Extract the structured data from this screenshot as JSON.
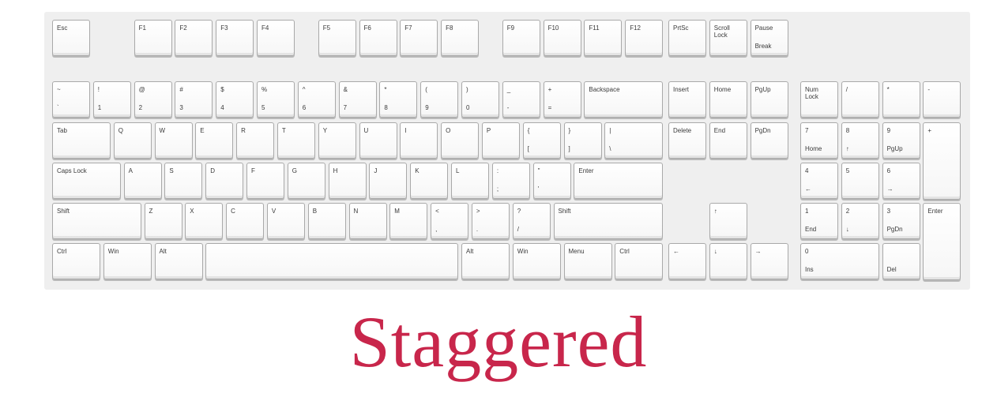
{
  "title": "Staggered",
  "colors": {
    "title": "#c8264b",
    "keycap": "#ffffff",
    "keycap_border": "#a9a9a9",
    "board": "#efefef"
  },
  "rows": {
    "function": [
      {
        "id": "esc",
        "top": "Esc"
      },
      {
        "id": "f1",
        "top": "F1"
      },
      {
        "id": "f2",
        "top": "F2"
      },
      {
        "id": "f3",
        "top": "F3"
      },
      {
        "id": "f4",
        "top": "F4"
      },
      {
        "id": "f5",
        "top": "F5"
      },
      {
        "id": "f6",
        "top": "F6"
      },
      {
        "id": "f7",
        "top": "F7"
      },
      {
        "id": "f8",
        "top": "F8"
      },
      {
        "id": "f9",
        "top": "F9"
      },
      {
        "id": "f10",
        "top": "F10"
      },
      {
        "id": "f11",
        "top": "F11"
      },
      {
        "id": "f12",
        "top": "F12"
      },
      {
        "id": "prtsc",
        "top": "PrtSc"
      },
      {
        "id": "scroll-lock",
        "top": "Scroll\nLock"
      },
      {
        "id": "pause",
        "top": "Pause",
        "bottom": "Break"
      }
    ],
    "number": [
      {
        "id": "backtick",
        "top": "~",
        "bottom": "`"
      },
      {
        "id": "1",
        "top": "!",
        "bottom": "1"
      },
      {
        "id": "2",
        "top": "@",
        "bottom": "2"
      },
      {
        "id": "3",
        "top": "#",
        "bottom": "3"
      },
      {
        "id": "4",
        "top": "$",
        "bottom": "4"
      },
      {
        "id": "5",
        "top": "%",
        "bottom": "5"
      },
      {
        "id": "6",
        "top": "^",
        "bottom": "6"
      },
      {
        "id": "7",
        "top": "&",
        "bottom": "7"
      },
      {
        "id": "8",
        "top": "*",
        "bottom": "8"
      },
      {
        "id": "9",
        "top": "(",
        "bottom": "9"
      },
      {
        "id": "0",
        "top": ")",
        "bottom": "0"
      },
      {
        "id": "minus",
        "top": "_",
        "bottom": "-"
      },
      {
        "id": "equals",
        "top": "+",
        "bottom": "="
      },
      {
        "id": "backspace",
        "top": "Backspace"
      },
      {
        "id": "insert",
        "top": "Insert"
      },
      {
        "id": "home",
        "top": "Home"
      },
      {
        "id": "pgup",
        "top": "PgUp"
      },
      {
        "id": "num-lock",
        "top": "Num\nLock"
      },
      {
        "id": "num-slash",
        "top": "/"
      },
      {
        "id": "num-star",
        "top": "*"
      },
      {
        "id": "num-minus",
        "top": "-"
      }
    ],
    "top": [
      {
        "id": "tab",
        "top": "Tab"
      },
      {
        "id": "q",
        "top": "Q"
      },
      {
        "id": "w",
        "top": "W"
      },
      {
        "id": "e",
        "top": "E"
      },
      {
        "id": "r",
        "top": "R"
      },
      {
        "id": "t",
        "top": "T"
      },
      {
        "id": "y",
        "top": "Y"
      },
      {
        "id": "u",
        "top": "U"
      },
      {
        "id": "i",
        "top": "I"
      },
      {
        "id": "o",
        "top": "O"
      },
      {
        "id": "p",
        "top": "P"
      },
      {
        "id": "lbracket",
        "top": "{",
        "bottom": "["
      },
      {
        "id": "rbracket",
        "top": "}",
        "bottom": "]"
      },
      {
        "id": "backslash",
        "top": "|",
        "bottom": "\\"
      },
      {
        "id": "delete",
        "top": "Delete"
      },
      {
        "id": "end",
        "top": "End"
      },
      {
        "id": "pgdn",
        "top": "PgDn"
      },
      {
        "id": "num7",
        "top": "7",
        "bottom": "Home"
      },
      {
        "id": "num8",
        "top": "8",
        "bottom": "↑"
      },
      {
        "id": "num9",
        "top": "9",
        "bottom": "PgUp"
      },
      {
        "id": "num-plus",
        "top": "+"
      }
    ],
    "home": [
      {
        "id": "caps-lock",
        "top": "Caps Lock"
      },
      {
        "id": "a",
        "top": "A"
      },
      {
        "id": "s",
        "top": "S"
      },
      {
        "id": "d",
        "top": "D"
      },
      {
        "id": "f",
        "top": "F"
      },
      {
        "id": "g",
        "top": "G"
      },
      {
        "id": "h",
        "top": "H"
      },
      {
        "id": "j",
        "top": "J"
      },
      {
        "id": "k",
        "top": "K"
      },
      {
        "id": "l",
        "top": "L"
      },
      {
        "id": "semicolon",
        "top": ":",
        "bottom": ";"
      },
      {
        "id": "quote",
        "top": "\"",
        "bottom": "'"
      },
      {
        "id": "enter",
        "top": "Enter"
      },
      {
        "id": "num4",
        "top": "4",
        "bottom": "←"
      },
      {
        "id": "num5",
        "top": "5"
      },
      {
        "id": "num6",
        "top": "6",
        "bottom": "→"
      }
    ],
    "bottom": [
      {
        "id": "lshift",
        "top": "Shift"
      },
      {
        "id": "z",
        "top": "Z"
      },
      {
        "id": "x",
        "top": "X"
      },
      {
        "id": "c",
        "top": "C"
      },
      {
        "id": "v",
        "top": "V"
      },
      {
        "id": "b",
        "top": "B"
      },
      {
        "id": "n",
        "top": "N"
      },
      {
        "id": "m",
        "top": "M"
      },
      {
        "id": "comma",
        "top": "<",
        "bottom": ","
      },
      {
        "id": "period",
        "top": ">",
        "bottom": "."
      },
      {
        "id": "slash",
        "top": "?",
        "bottom": "/"
      },
      {
        "id": "rshift",
        "top": "Shift"
      },
      {
        "id": "up",
        "top": "↑"
      },
      {
        "id": "num1",
        "top": "1",
        "bottom": "End"
      },
      {
        "id": "num2",
        "top": "2",
        "bottom": "↓"
      },
      {
        "id": "num3",
        "top": "3",
        "bottom": "PgDn"
      },
      {
        "id": "num-enter",
        "top": "Enter"
      }
    ],
    "space": [
      {
        "id": "lctrl",
        "top": "Ctrl"
      },
      {
        "id": "lwin",
        "top": "Win"
      },
      {
        "id": "lalt",
        "top": "Alt"
      },
      {
        "id": "space",
        "top": ""
      },
      {
        "id": "ralt",
        "top": "Alt"
      },
      {
        "id": "rwin",
        "top": "Win"
      },
      {
        "id": "menu",
        "top": "Menu"
      },
      {
        "id": "rctrl",
        "top": "Ctrl"
      },
      {
        "id": "left",
        "top": "←"
      },
      {
        "id": "down",
        "top": "↓"
      },
      {
        "id": "right",
        "top": "→"
      },
      {
        "id": "num0",
        "top": "0",
        "bottom": "Ins"
      },
      {
        "id": "num-del",
        "top": "",
        "bottom": "Del"
      }
    ]
  }
}
